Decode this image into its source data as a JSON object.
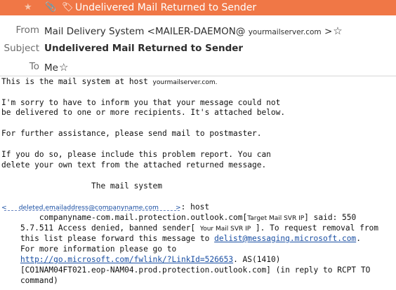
{
  "tab": {
    "star_glyph": "★",
    "clip_glyph": "📎",
    "tag_glyph": "🏷",
    "subject": "Undelivered Mail Returned to Sender",
    "color": "#f07746"
  },
  "header": {
    "from_label": "From",
    "from_name": "Mail Delivery System <MAILER-DAEMON@",
    "from_domain": "yourmailserver.com",
    "from_close": ">",
    "subject_label": "Subject",
    "subject_value": "Undelivered Mail Returned to Sender",
    "to_label": "To",
    "to_value": "Me"
  },
  "body": {
    "l1a": "This is the mail system at host ",
    "l1b": "yourmailserver.com.",
    "l2": "I'm sorry to have to inform you that your message could not",
    "l3": "be delivered to one or more recipients. It's attached below.",
    "l4": "For further assistance, please send mail to postmaster.",
    "l5": "If you do so, please include this problem report. You can",
    "l6": "delete your own text from the attached returned message.",
    "l7": "                   The mail system",
    "recipient_open": "<",
    "recipient": "deleted.emailaddress@companyname.com",
    "recipient_close": ">",
    "recipient_rest": ": host",
    "l9a": "        companyname-com.mail.protection.outlook.com[",
    "l9b": "Target Mail SVR IP",
    "l9c": "] said: 550",
    "l10a": "    5.7.511 Access denied, banned sender[ ",
    "l10b": "Your Mail SVR IP",
    "l10c": " ]. To request removal from",
    "l11a": "    this list please forward this message to ",
    "l11link": "delist@messaging.microsoft.com",
    "l11c": ".",
    "l12": "    For more information please go to",
    "l13pre": "    ",
    "l13link": "http://go.microsoft.com/fwlink/?LinkId=526653",
    "l13c": ". AS(1410)",
    "l14": "    [CO1NAM04FT021.eop-NAM04.prod.protection.outlook.com] (in reply to RCPT TO",
    "l15": "    command)"
  }
}
